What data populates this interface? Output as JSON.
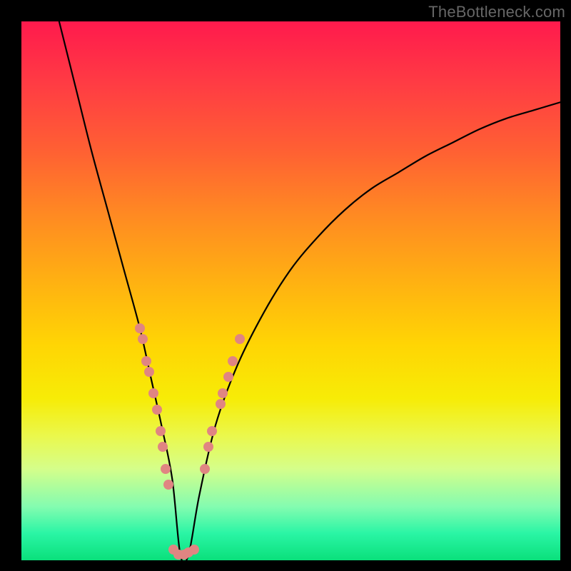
{
  "attribution": "TheBottleneck.com",
  "colors": {
    "gradient_top": "#ff1a4d",
    "gradient_mid": "#ffd504",
    "gradient_bottom": "#0ae07b",
    "curve": "#000000",
    "marker": "#e08582",
    "attribution_text": "#666666",
    "frame_bg": "#000000"
  },
  "chart_data": {
    "type": "line",
    "title": "",
    "xlabel": "",
    "ylabel": "",
    "xlim": [
      0,
      100
    ],
    "ylim": [
      0,
      100
    ],
    "x_optimum": 30,
    "curve": {
      "comment": "Approximate V-shaped bottleneck curve; y=0 is ideal (bottom/green), y=100 is worst (top/red).",
      "x": [
        7,
        10,
        13,
        16,
        19,
        22,
        24,
        26,
        28,
        29.5,
        31,
        33,
        36,
        40,
        45,
        50,
        55,
        60,
        65,
        70,
        75,
        80,
        85,
        90,
        95,
        100
      ],
      "y": [
        100,
        88,
        76,
        65,
        54,
        43,
        34,
        25,
        15,
        1,
        1,
        12,
        25,
        36,
        46,
        54,
        60,
        65,
        69,
        72,
        75,
        77.5,
        80,
        82,
        83.5,
        85
      ]
    },
    "markers": {
      "comment": "Pink sample dots clustered near the valley of the curve.",
      "points": [
        {
          "x": 22.0,
          "y": 43
        },
        {
          "x": 22.5,
          "y": 41
        },
        {
          "x": 23.2,
          "y": 37
        },
        {
          "x": 23.7,
          "y": 35
        },
        {
          "x": 24.5,
          "y": 31
        },
        {
          "x": 25.1,
          "y": 28
        },
        {
          "x": 25.8,
          "y": 24
        },
        {
          "x": 26.2,
          "y": 21
        },
        {
          "x": 26.8,
          "y": 17
        },
        {
          "x": 27.3,
          "y": 14
        },
        {
          "x": 28.2,
          "y": 2
        },
        {
          "x": 29.2,
          "y": 1
        },
        {
          "x": 30.2,
          "y": 1
        },
        {
          "x": 31.0,
          "y": 1.5
        },
        {
          "x": 32.0,
          "y": 2
        },
        {
          "x": 34.0,
          "y": 17
        },
        {
          "x": 34.7,
          "y": 21
        },
        {
          "x": 35.4,
          "y": 24
        },
        {
          "x": 36.9,
          "y": 29
        },
        {
          "x": 37.4,
          "y": 31
        },
        {
          "x": 38.4,
          "y": 34
        },
        {
          "x": 39.2,
          "y": 37
        },
        {
          "x": 40.5,
          "y": 41
        }
      ]
    }
  }
}
